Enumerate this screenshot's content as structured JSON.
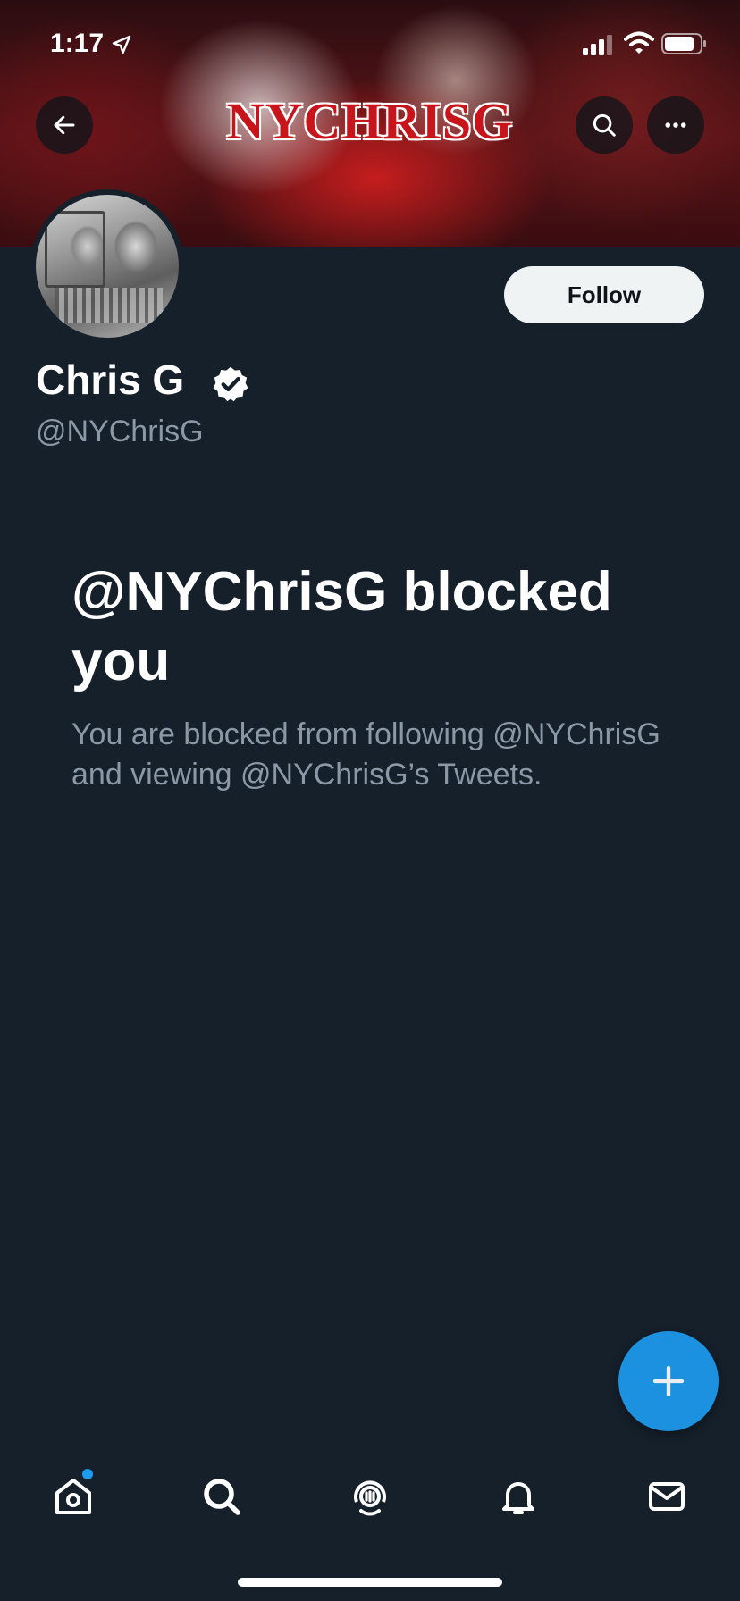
{
  "status_bar": {
    "time": "1:17"
  },
  "banner": {
    "title": "NYCHRISG"
  },
  "header": {
    "back_icon": "arrow-left-icon",
    "search_icon": "search-icon",
    "more_icon": "more-horizontal-icon"
  },
  "profile": {
    "display_name": "Chris G",
    "verified": true,
    "handle": "@NYChrisG",
    "follow_label": "Follow"
  },
  "blocked": {
    "title": "@NYChrisG blocked you",
    "description": "You are blocked from following @NYChrisG and viewing @NYChrisG’s Tweets."
  },
  "fab": {
    "icon": "plus-icon"
  },
  "tabbar": {
    "items": [
      "home-icon",
      "search-icon",
      "spaces-icon",
      "notifications-icon",
      "messages-icon"
    ],
    "home_has_notification_dot": true
  },
  "colors": {
    "background": "#15202b",
    "accent": "#1d9bf0",
    "secondary_text": "#8b98a5",
    "follow_button_bg": "#eff3f4",
    "banner_text": "#c8141b"
  }
}
